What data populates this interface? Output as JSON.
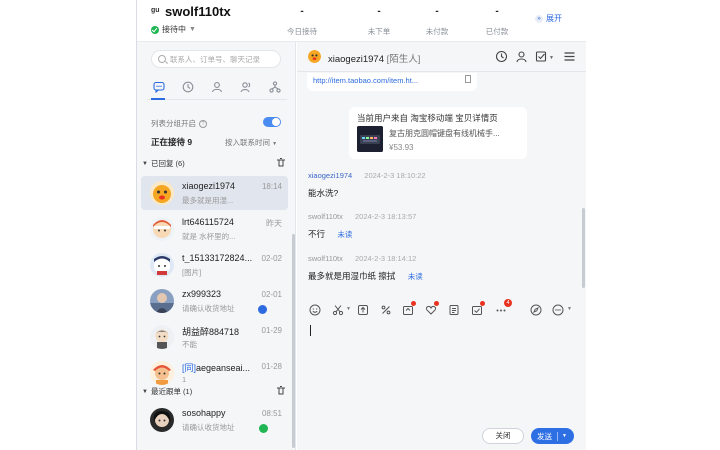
{
  "header": {
    "logo": "gu",
    "user_name": "swolf110tx",
    "status": "接待中",
    "stats": [
      {
        "value": "-",
        "label": "今日接待"
      },
      {
        "value": "-",
        "label": "未下单"
      },
      {
        "value": "-",
        "label": "未付款"
      },
      {
        "value": "-",
        "label": "已付款"
      }
    ],
    "expand_label": "展开"
  },
  "sidebar": {
    "search_placeholder": "联系人、订单号、聊天记录",
    "tabs": [
      {
        "name": "chat-bubble-icon",
        "active": true
      },
      {
        "name": "clock-icon",
        "active": false
      },
      {
        "name": "person-icon",
        "active": false
      },
      {
        "name": "contacts-icon",
        "active": false
      },
      {
        "name": "org-tree-icon",
        "active": false
      }
    ],
    "group_label": "列表分组开启",
    "toggle_on": true,
    "serving_label": "正在接待 9",
    "sort_label": "按入联系时间",
    "sections": [
      {
        "title": "已回复",
        "count": "(6)"
      },
      {
        "title": "最近跟单",
        "count": "(1)"
      }
    ],
    "contacts": [
      {
        "tag": "",
        "name": "xiaogezi1974",
        "time": "18:14",
        "preview": "最多就是用湿...",
        "selected": true,
        "badge": ""
      },
      {
        "tag": "",
        "name": "lrt646115724",
        "time": "昨天",
        "preview": "就是 水杯里的...",
        "selected": false,
        "badge": ""
      },
      {
        "tag": "",
        "name": "t_15133172824...",
        "time": "02-02",
        "preview": "[图片]",
        "selected": false,
        "badge": ""
      },
      {
        "tag": "",
        "name": "zx999323",
        "time": "02-01",
        "preview": "请确认收货地址",
        "selected": false,
        "badge": "#2c6be0"
      },
      {
        "tag": "",
        "name": "胡益醉884718",
        "time": "01-29",
        "preview": "不能",
        "selected": false,
        "badge": ""
      },
      {
        "tag": "[同]",
        "name": "aegeanseai...",
        "time": "01-28",
        "preview": "1",
        "selected": false,
        "badge": ""
      },
      {
        "tag": "",
        "name": "sosohappy",
        "time": "08:51",
        "preview": "请确认收货地址",
        "selected": false,
        "badge": "#1fb653"
      }
    ]
  },
  "chat": {
    "title_name": "xiaogezi1974",
    "title_suffix": "[陌生人]",
    "link_text": "http://item.taobao.com/item.ht...",
    "product_card": {
      "title": "当前用户来自 淘宝移动端 宝贝详情页",
      "name": "复古朋克圆帽键盘有线机械手...",
      "price": "¥53.93"
    },
    "messages": [
      {
        "sender": "xiaogezi1974",
        "time": "2024-2-3 18:10:22",
        "text": "能水洗?",
        "role": "buyer",
        "unread": ""
      },
      {
        "sender": "swolf110tx",
        "time": "2024-2-3 18:13:57",
        "text": "不行",
        "role": "seller",
        "unread": "未读"
      },
      {
        "sender": "swolf110tx",
        "time": "2024-2-3 18:14:12",
        "text": "最多就是用湿巾纸 擦拭",
        "role": "seller",
        "unread": "未读"
      }
    ],
    "toolbar_count": "4",
    "close_label": "关闭",
    "send_label": "发送"
  },
  "colors": {
    "accent": "#2c6be0",
    "online": "#1fb653",
    "notification": "#e8321f"
  }
}
